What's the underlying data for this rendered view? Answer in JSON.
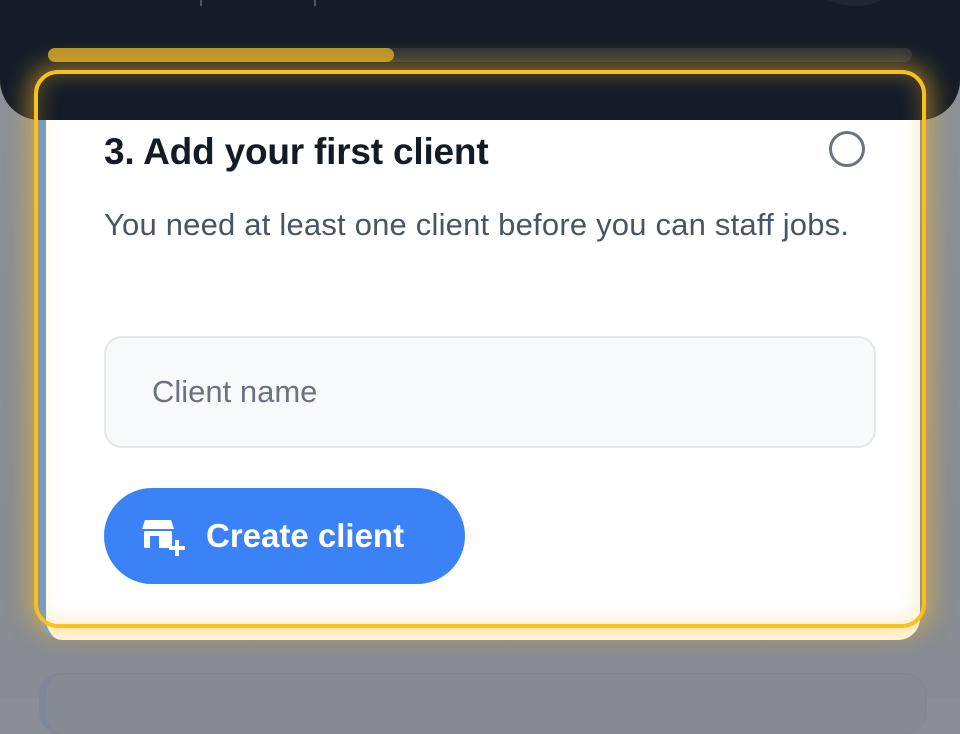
{
  "header": {
    "progress_percent": 40
  },
  "step": {
    "title": "3. Add your first client",
    "description": "You need at least one client before you can staff jobs.",
    "completed": false
  },
  "client_form": {
    "name_placeholder": "Client name",
    "name_value": "",
    "create_label": "Create client"
  },
  "icons": {
    "create": "storefront-plus-icon",
    "status": "circle-outline-icon"
  },
  "colors": {
    "accent": "#3b82f6",
    "highlight": "#fbbf24",
    "header": "#151c28",
    "progress_fill": "#b8922a",
    "card_border": "#6a99d0"
  }
}
